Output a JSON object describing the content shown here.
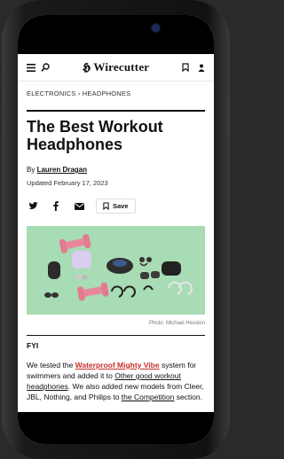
{
  "header": {
    "logo": "𝕳 Wirecutter"
  },
  "breadcrumb": "ELECTRONICS › HEADPHONES",
  "article": {
    "title": "The Best Workout Headphones",
    "byline_prefix": "By ",
    "author": "Lauren Dragan",
    "updated": "Updated February 17, 2023"
  },
  "share": {
    "save_label": "Save"
  },
  "hero": {
    "credit": "Photo: Michael Hession"
  },
  "fyi": {
    "heading": "FYI",
    "p1": "We tested the ",
    "link1": "Waterproof Mighty Vibe",
    "p2": " system for swimmers and added it to ",
    "link2": "Other good workout headphones",
    "p3": ". We also added new models from Cleer, JBL, Nothing, and Philips to ",
    "link3": "the Competition",
    "p4": " section."
  },
  "icons": {
    "menu": "menu-icon",
    "search": "search-icon",
    "bookmark": "bookmark-icon",
    "account": "account-icon",
    "twitter": "twitter-icon",
    "facebook": "facebook-icon",
    "email": "email-icon"
  },
  "colors": {
    "hero_bg": "#a8dcb4",
    "link_red": "#c7302a"
  }
}
